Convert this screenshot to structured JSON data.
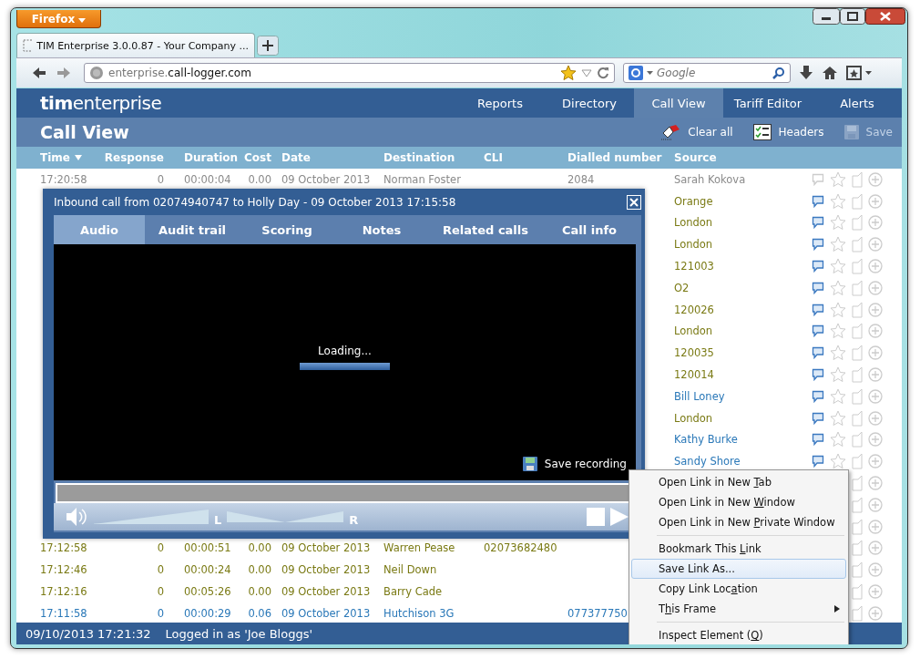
{
  "browser": {
    "menu_button": "Firefox",
    "tab_title": "TIM Enterprise 3.0.0.87 - Your Company ...",
    "url": {
      "prefix": "enterprise.",
      "domain": "call-logger.com"
    },
    "search": {
      "placeholder": "Google"
    }
  },
  "app": {
    "logo": [
      "tim",
      "enterprise"
    ],
    "nav": [
      {
        "label": "Reports",
        "selected": false
      },
      {
        "label": "Directory",
        "selected": false
      },
      {
        "label": "Call View",
        "selected": true
      },
      {
        "label": "Tariff Editor",
        "selected": false
      },
      {
        "label": "Alerts",
        "selected": false
      }
    ],
    "page_title": "Call View",
    "toolbar": [
      {
        "kind": "clear",
        "label": "Clear all",
        "disabled": false
      },
      {
        "kind": "headers",
        "label": "Headers",
        "disabled": false
      },
      {
        "kind": "save",
        "label": "Save",
        "disabled": true
      }
    ],
    "table": {
      "columns": [
        {
          "label": "Time",
          "sorted": true
        },
        {
          "label": "Response",
          "sorted": false
        },
        {
          "label": "Duration",
          "sorted": false
        },
        {
          "label": "Cost",
          "sorted": false
        },
        {
          "label": "Date",
          "sorted": false
        },
        {
          "label": "Destination",
          "sorted": false
        },
        {
          "label": "CLI",
          "sorted": false
        },
        {
          "label": "Dialled number",
          "sorted": false
        },
        {
          "label": "Source",
          "sorted": false
        }
      ],
      "rows": [
        {
          "cells": [
            "17:20:58",
            "0",
            "00:00:04",
            "0.00",
            "09 October 2013",
            "Norman Foster",
            null,
            "2084",
            "Sarah Kokova"
          ],
          "color": "#8a8a8a",
          "comment": false
        },
        {
          "cells": [
            null,
            null,
            null,
            null,
            null,
            null,
            null,
            null,
            "Orange"
          ],
          "color": "#7a7a14",
          "comment": true
        },
        {
          "cells": [
            null,
            null,
            null,
            null,
            null,
            null,
            null,
            null,
            "London"
          ],
          "color": "#7a7a14",
          "comment": true
        },
        {
          "cells": [
            null,
            null,
            null,
            null,
            null,
            null,
            null,
            null,
            "London"
          ],
          "color": "#7a7a14",
          "comment": true
        },
        {
          "cells": [
            null,
            null,
            null,
            null,
            null,
            null,
            null,
            null,
            "121003"
          ],
          "color": "#7a7a14",
          "comment": true
        },
        {
          "cells": [
            null,
            null,
            null,
            null,
            null,
            null,
            null,
            null,
            "O2"
          ],
          "color": "#7a7a14",
          "comment": true
        },
        {
          "cells": [
            null,
            null,
            null,
            null,
            null,
            null,
            null,
            null,
            "120026"
          ],
          "color": "#7a7a14",
          "comment": true
        },
        {
          "cells": [
            null,
            null,
            null,
            null,
            null,
            null,
            null,
            null,
            "London"
          ],
          "color": "#7a7a14",
          "comment": true
        },
        {
          "cells": [
            null,
            null,
            null,
            null,
            null,
            null,
            null,
            null,
            "120035"
          ],
          "color": "#7a7a14",
          "comment": true
        },
        {
          "cells": [
            null,
            null,
            null,
            null,
            null,
            null,
            null,
            null,
            "120014"
          ],
          "color": "#7a7a14",
          "comment": true
        },
        {
          "cells": [
            null,
            null,
            null,
            null,
            null,
            null,
            null,
            null,
            "Bill Loney"
          ],
          "color": "#2a78b8",
          "comment": true
        },
        {
          "cells": [
            null,
            null,
            null,
            null,
            null,
            null,
            null,
            null,
            "London"
          ],
          "color": "#7a7a14",
          "comment": true
        },
        {
          "cells": [
            null,
            null,
            null,
            null,
            null,
            null,
            null,
            null,
            "Kathy Burke"
          ],
          "color": "#2a78b8",
          "comment": true
        },
        {
          "cells": [
            null,
            null,
            null,
            null,
            null,
            null,
            null,
            null,
            "Sandy Shore"
          ],
          "color": "#2a78b8",
          "comment": true
        },
        {
          "cells": [
            null,
            null,
            null,
            null,
            null,
            null,
            null,
            null,
            null
          ]
        },
        {
          "cells": [
            null,
            null,
            null,
            null,
            null,
            null,
            null,
            null,
            null
          ]
        },
        {
          "cells": [
            null,
            null,
            null,
            null,
            null,
            null,
            null,
            null,
            null
          ]
        },
        {
          "cells": [
            "17:12:58",
            "0",
            "00:00:51",
            "0.00",
            "09 October 2013",
            "Warren Pease",
            "02073682480",
            null,
            null
          ],
          "color": "#7a7a14"
        },
        {
          "cells": [
            "17:12:46",
            "0",
            "00:00:24",
            "0.00",
            "09 October 2013",
            "Neil Down",
            null,
            null,
            null
          ],
          "color": "#7a7a14"
        },
        {
          "cells": [
            "17:12:16",
            "0",
            "00:05:26",
            "0.00",
            "09 October 2013",
            "Barry Cade",
            null,
            null,
            null
          ],
          "color": "#7a7a14"
        },
        {
          "cells": [
            "17:11:58",
            "0",
            "00:00:29",
            "0.06",
            "09 October 2013",
            "Hutchison 3G",
            null,
            "077377750",
            null
          ],
          "color": "#2a78b8"
        }
      ]
    },
    "status": {
      "datetime": "09/10/2013 17:21:32",
      "user": "Logged in as 'Joe Bloggs'"
    }
  },
  "dialog": {
    "title": "Inbound call from 02074940747 to Holly Day - 09 October 2013 17:15:58",
    "tabs": [
      {
        "label": "Audio",
        "selected": true
      },
      {
        "label": "Audit trail",
        "selected": false
      },
      {
        "label": "Scoring",
        "selected": false
      },
      {
        "label": "Notes",
        "selected": false
      },
      {
        "label": "Related calls",
        "selected": false
      },
      {
        "label": "Call info",
        "selected": false
      }
    ],
    "loading": "Loading...",
    "save_label": "Save recording",
    "volume": {
      "level": 1
    },
    "balance": {
      "labels": [
        "L",
        "R"
      ],
      "level": 0.5
    }
  },
  "context_menu": [
    {
      "kind": "item",
      "parts": [
        "Open Link in New ",
        "T",
        "ab"
      ],
      "selected": false,
      "submenu": false
    },
    {
      "kind": "item",
      "parts": [
        "Open Link in New ",
        "W",
        "indow"
      ],
      "selected": false,
      "submenu": false
    },
    {
      "kind": "item",
      "parts": [
        "Open Link in New ",
        "P",
        "rivate Window"
      ],
      "selected": false,
      "submenu": false
    },
    {
      "kind": "separator"
    },
    {
      "kind": "item",
      "parts": [
        "Bookmark This ",
        "L",
        "ink"
      ],
      "selected": false,
      "submenu": false
    },
    {
      "kind": "item",
      "parts": [
        "Save Link As..."
      ],
      "selected": true,
      "submenu": false
    },
    {
      "kind": "item",
      "parts": [
        "Copy Link Loc",
        "a",
        "tion"
      ],
      "selected": false,
      "submenu": false
    },
    {
      "kind": "item",
      "parts": [
        "T",
        "h",
        "is Frame"
      ],
      "selected": false,
      "submenu": true
    },
    {
      "kind": "separator"
    },
    {
      "kind": "item",
      "parts": [
        "Inspect Element (",
        "Q",
        ")"
      ],
      "selected": false,
      "submenu": false
    }
  ]
}
